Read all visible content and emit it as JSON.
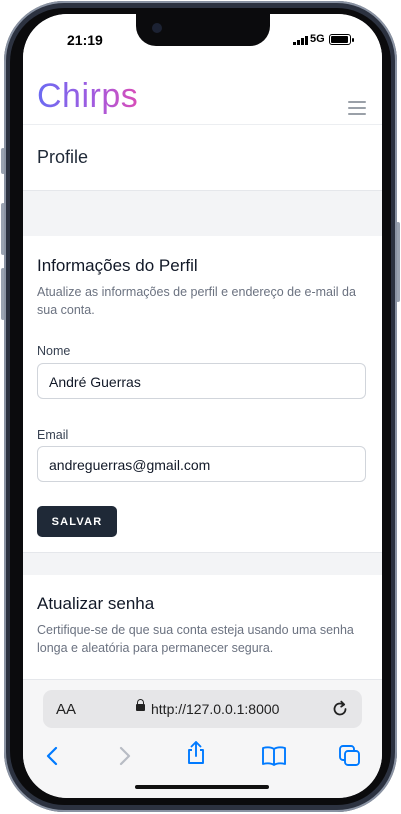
{
  "status_bar": {
    "time": "21:19",
    "network": "5G"
  },
  "app": {
    "logo": "Chirps"
  },
  "page": {
    "title": "Profile"
  },
  "profile_info": {
    "heading": "Informações do Perfil",
    "description": "Atualize as informações de perfil e endereço de e-mail da sua conta.",
    "name_label": "Nome",
    "name_value": "André Guerras",
    "email_label": "Email",
    "email_value": "andreguerras@gmail.com",
    "save_label": "SALVAR"
  },
  "update_password": {
    "heading": "Atualizar senha",
    "description": "Certifique-se de que sua conta esteja usando uma senha longa e aleatória para permanecer segura."
  },
  "browser": {
    "text_size_label": "AA",
    "url": "http://127.0.0.1:8000",
    "icons": [
      "back-icon",
      "forward-icon",
      "share-icon",
      "bookmarks-icon",
      "tabs-icon",
      "reload-icon",
      "lock-icon"
    ]
  },
  "colors": {
    "logo_gradient_start": "#6b6bf2",
    "logo_gradient_end": "#d84db8",
    "button_bg": "#1f2937",
    "ios_blue": "#007aff"
  }
}
